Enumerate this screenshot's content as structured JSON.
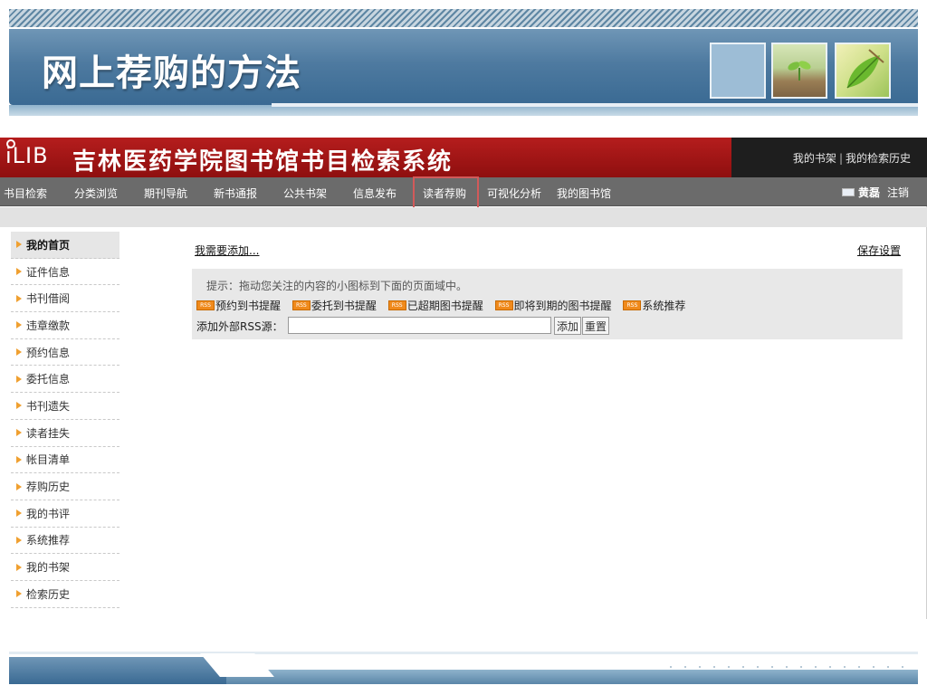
{
  "slide": {
    "title": "网上荐购的方法"
  },
  "app": {
    "logo": "iLIB",
    "title": "吉林医药学院图书馆书目检索系统",
    "top_links": [
      "我的书架",
      "我的检索历史"
    ],
    "top_links_separator": "|",
    "nav_items": [
      "书目检索",
      "分类浏览",
      "期刊导航",
      "新书通报",
      "公共书架",
      "信息发布",
      "读者荐购",
      "可视化分析",
      "我的图书馆"
    ],
    "active_nav": "读者荐购",
    "user_name": "黄磊",
    "logout_label": "注销",
    "sidebar_items": [
      "我的首页",
      "证件信息",
      "书刊借阅",
      "违章缴款",
      "预约信息",
      "委托信息",
      "书刊遗失",
      "读者挂失",
      "帐目清单",
      "荐购历史",
      "我的书评",
      "系统推荐",
      "我的书架",
      "检索历史"
    ],
    "main": {
      "add_link": "我需要添加...",
      "save_link": "保存设置",
      "hint": "提示：拖动您关注的内容的小图标到下面的页面域中。",
      "rss_badge": "RSS",
      "rss_items": [
        "预约到书提醒",
        "委托到书提醒",
        "已超期图书提醒",
        "即将到期的图书提醒",
        "系统推荐"
      ],
      "external_rss_label": "添加外部RSS源：",
      "external_rss_value": "",
      "add_button": "添加",
      "reset_button": "重置"
    }
  },
  "colors": {
    "header_red": "#a01414",
    "nav_gray": "#6b6b6b",
    "slide_blue": "#4e7aa0",
    "rss_orange": "#f08a1c",
    "active_outline": "#d25a5a"
  }
}
